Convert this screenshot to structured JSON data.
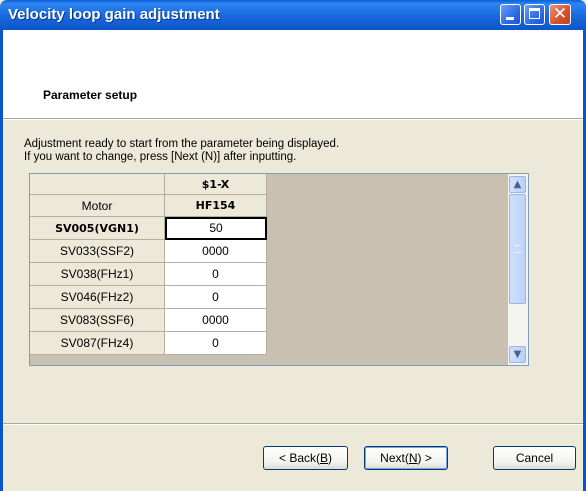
{
  "window": {
    "title": "Velocity loop gain adjustment"
  },
  "header": {
    "heading": "Parameter setup"
  },
  "instructions": [
    "Adjustment ready to start from the parameter being displayed.",
    "If you want to change, press [Next (N)] after inputting."
  ],
  "grid": {
    "column_header": "$1-X",
    "rows": [
      {
        "label": "Motor",
        "value": "HF154"
      },
      {
        "label": "SV005(VGN1)",
        "value": "50"
      },
      {
        "label": "SV033(SSF2)",
        "value": "0000"
      },
      {
        "label": "SV038(FHz1)",
        "value": "0"
      },
      {
        "label": "SV046(FHz2)",
        "value": "0"
      },
      {
        "label": "SV083(SSF6)",
        "value": "0000"
      },
      {
        "label": "SV087(FHz4)",
        "value": "0"
      }
    ]
  },
  "buttons": {
    "back": {
      "pre": "< Back(",
      "mn": "B",
      "post": ")"
    },
    "next": {
      "pre": "Next(",
      "mn": "N",
      "post": ") >"
    },
    "cancel": "Cancel"
  },
  "icons": {
    "minimize": "minimize-icon",
    "maximize": "maximize-icon",
    "close": "close-icon",
    "scroll_up": "chevron-up-icon",
    "scroll_down": "chevron-down-icon"
  },
  "colors": {
    "titlebar": "#0c55c8",
    "close": "#d4512a",
    "window_bg": "#ece9d8"
  }
}
